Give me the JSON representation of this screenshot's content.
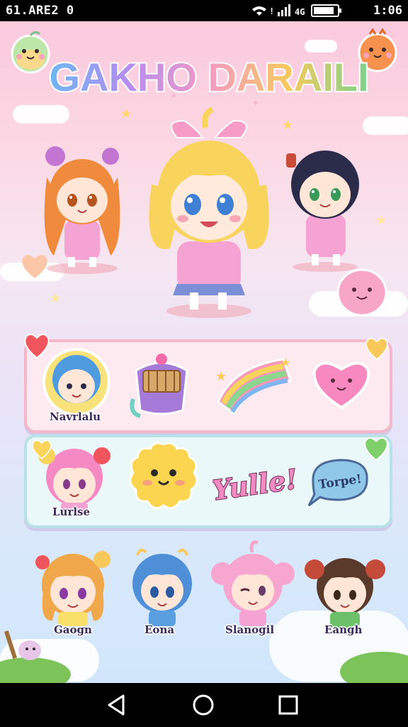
{
  "status_bar": {
    "left_text": "61.ARE2 0",
    "time": "1:06",
    "icons": [
      "alert-icon",
      "wifi-icon",
      "signal-icon",
      "battery-icon"
    ]
  },
  "app": {
    "title": "GAKHO DARAILI"
  },
  "panel1": {
    "items": [
      {
        "label": "Navrlalu",
        "icon": "blue-hair-girl-sticker"
      },
      {
        "label": "",
        "icon": "treasure-bag-sticker"
      },
      {
        "label": "",
        "icon": "rainbow-sticker"
      },
      {
        "label": "",
        "icon": "pink-heart-sticker"
      }
    ]
  },
  "panel2": {
    "items": [
      {
        "label": "Lurlse",
        "icon": "pink-hair-girl-sticker"
      },
      {
        "label": "",
        "icon": "yellow-blob-sticker"
      },
      {
        "label": "Yulle!",
        "icon": "text-sticker"
      },
      {
        "label": "Torpe!",
        "icon": "speech-bubble-sticker"
      }
    ]
  },
  "bottom_row": [
    {
      "label": "Gaogn",
      "icon": "orange-hair-girl"
    },
    {
      "label": "Eona",
      "icon": "blue-hair-boy"
    },
    {
      "label": "Slanogil",
      "icon": "pink-hair-girl"
    },
    {
      "label": "Eangh",
      "icon": "brown-hair-girl"
    }
  ],
  "colors": {
    "title_gradient": [
      "#6fb6f2",
      "#b58cf0",
      "#f39ac2",
      "#f8c95d",
      "#7bd38a"
    ],
    "panel1_border": "#f3b7c9",
    "panel2_border": "#b8e2e6"
  },
  "nav": [
    "back-icon",
    "home-icon",
    "recents-icon"
  ]
}
